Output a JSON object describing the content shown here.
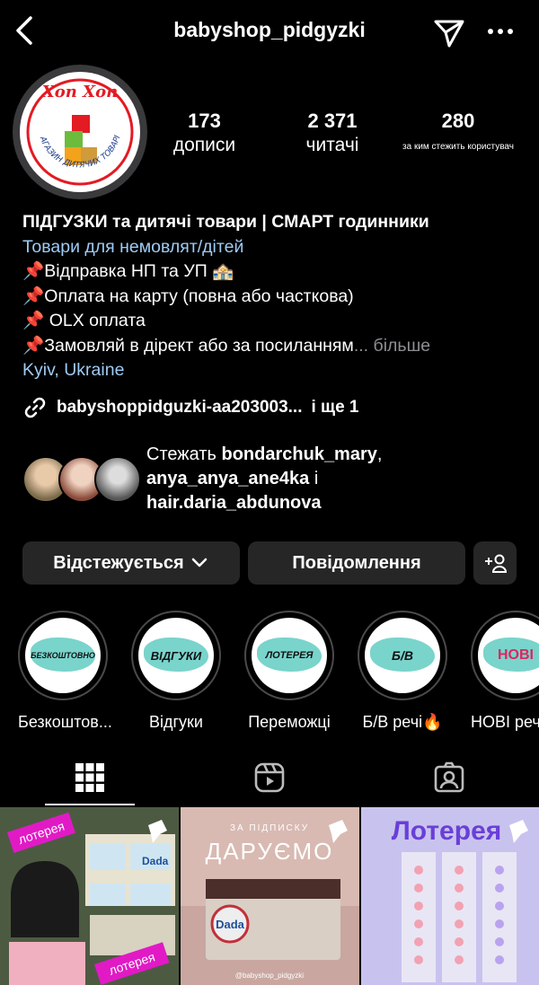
{
  "header": {
    "username": "babyshop_pidgyzki"
  },
  "avatar": {
    "logo_top": "Хоп Хоп",
    "logo_ring": "МАГАЗИН ДИТЯЧИХ ТОВАРІВ"
  },
  "stats": {
    "posts_count": "173",
    "posts_label": "дописи",
    "followers_count": "2 371",
    "followers_label": "читачі",
    "following_count": "280",
    "following_label": "за ким стежить користувач"
  },
  "bio": {
    "name": "ПІДГУЗКИ та дитячі товари | СМАРТ годинники",
    "category": "Товари для немовлят/дітей",
    "line1": "📌Відправка НП та УП 🏤",
    "line2": "📌Оплата на карту (повна або часткова)",
    "line3": "📌 OLX оплата",
    "line4": "📌Замовляй в дірект або за посиланням",
    "ellipsis": "...",
    "more": "більше",
    "location": "Kyiv, Ukraine",
    "link": "babyshoppidguzki-aa203003...",
    "link_more": "і ще 1"
  },
  "mutual": {
    "prefix": "Стежать",
    "user1": "bondarchuk_mary",
    "sep1": ",",
    "user2": "anya_anya_ane4ka",
    "sep2": "і",
    "user3": "hair.daria_abdunova"
  },
  "actions": {
    "following": "Відстежується",
    "message": "Повідомлення"
  },
  "highlights": [
    {
      "cover": "БЕЗКОШТОВНО",
      "caption": "Безкоштов..."
    },
    {
      "cover": "ВІДГУКИ",
      "caption": "Відгуки"
    },
    {
      "cover": "ЛОТЕРЕЯ",
      "caption": "Переможці"
    },
    {
      "cover": "Б/В",
      "caption": "Б/В речі🔥"
    },
    {
      "cover": "НОВІ",
      "caption": "НОВІ речі"
    }
  ],
  "posts": [
    {
      "tag1": "лотерея",
      "tag2": "лотерея",
      "brand": "Dada"
    },
    {
      "top": "ЗА ПІДПИСКУ",
      "headline": "ДАРУЄМО",
      "brand": "Dada",
      "handle": "@babyshop_pidgyzki"
    },
    {
      "headline": "Лотерея"
    }
  ],
  "colors": {
    "background": "#000000",
    "button": "#262626",
    "link_blue": "#9ecbf5",
    "highlight_blob": "#79d4cc"
  }
}
